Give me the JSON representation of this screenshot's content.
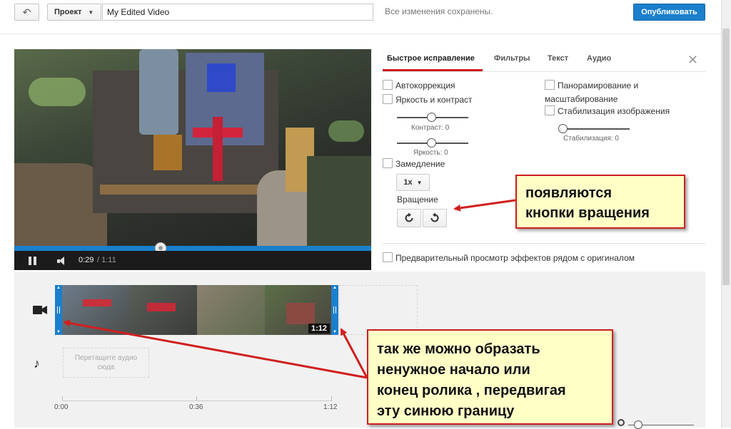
{
  "topbar": {
    "back_icon": "back-arrow-icon",
    "project_label": "Проект",
    "title_value": "My Edited Video",
    "saved_status": "Все изменения сохранены.",
    "publish_label": "Опубликовать"
  },
  "player": {
    "current_time": "0:29",
    "separator_total": "/ 1:11",
    "progress_fraction": 0.41,
    "accent_color": "#1b7fcc"
  },
  "panel": {
    "tabs": [
      {
        "label": "Быстрое исправление",
        "active": true
      },
      {
        "label": "Фильтры",
        "active": false
      },
      {
        "label": "Текст",
        "active": false
      },
      {
        "label": "Аудио",
        "active": false
      }
    ],
    "autocorrect": "Автокоррекция",
    "brightness_contrast": "Яркость и контраст",
    "contrast_caption": "Контраст: 0",
    "brightness_caption": "Яркость: 0",
    "slowmo": "Замедление",
    "speed_value": "1x",
    "rotation": "Вращение",
    "pan_zoom_line1": "Панорамирование и",
    "pan_zoom_line2": "масштабирование",
    "stabilize": "Стабилизация изображения",
    "stabilize_caption": "Стабилизация: 0",
    "preview_side_by_side": "Предварительный просмотр эффектов рядом с оригиналом"
  },
  "timeline": {
    "clip_duration": "1:12",
    "audio_drop_text": "Перетащите аудио сюда",
    "ticks": [
      "0:00",
      "0:36",
      "1:12"
    ]
  },
  "callouts": {
    "rotation_hint": "появляются\nкнопки вращения",
    "trim_hint": "так же можно образать\nненужное начало или\nконец ролика , передвигая\nэту синюю границу"
  }
}
